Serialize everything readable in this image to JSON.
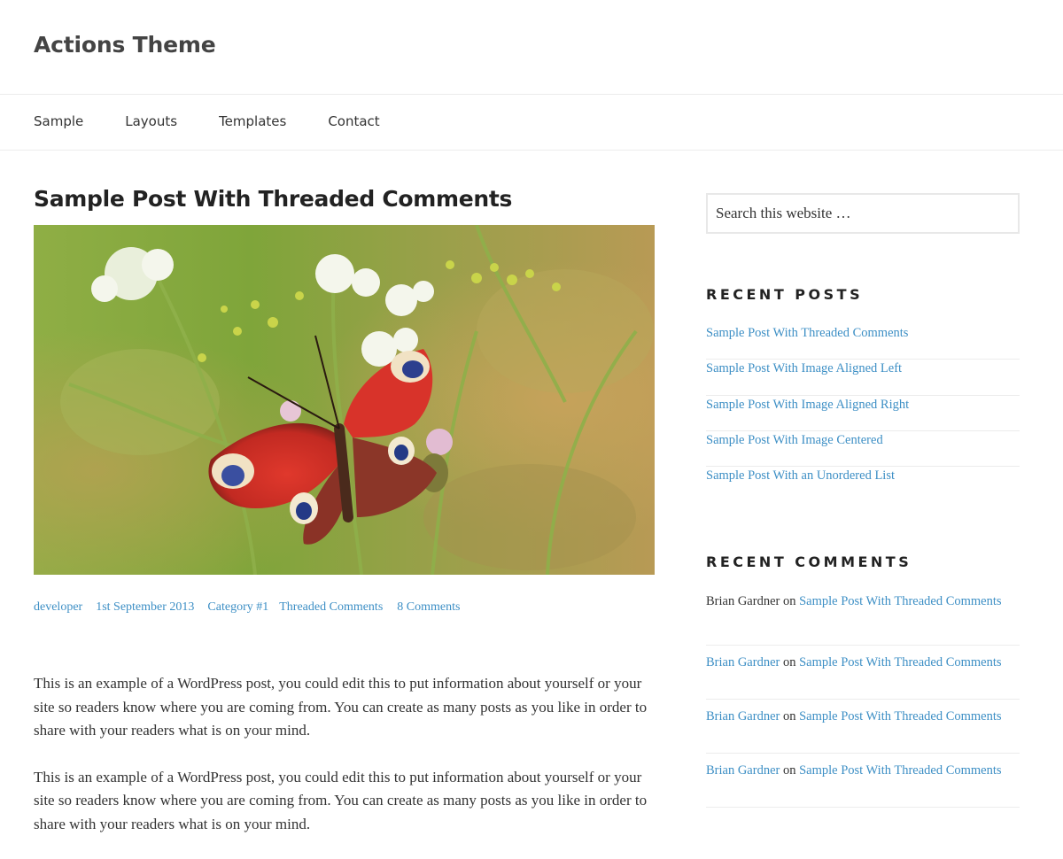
{
  "site": {
    "title": "Actions Theme"
  },
  "nav": {
    "items": [
      "Sample",
      "Layouts",
      "Templates",
      "Contact"
    ]
  },
  "post": {
    "title": "Sample Post With Threaded Comments",
    "meta": {
      "author": "developer",
      "date": "1st September 2013",
      "category": "Category #1",
      "tag": "Threaded Comments",
      "comments": "8 Comments"
    },
    "paragraphs": [
      "This is an example of a WordPress post, you could edit this to put information about yourself or your site so readers know where you are coming from. You can create as many posts as you like in order to share with your readers what is on your mind.",
      "This is an example of a WordPress post, you could edit this to put information about yourself or your site so readers know where you are coming from. You can create as many posts as you like in order to share with your readers what is on your mind."
    ]
  },
  "sidebar": {
    "search_placeholder": "Search this website …",
    "recent_posts": {
      "title": "RECENT POSTS",
      "items": [
        "Sample Post With Threaded Comments",
        "Sample Post With Image Aligned Left",
        "Sample Post With Image Aligned Right",
        "Sample Post With Image Centered",
        "Sample Post With an Unordered List"
      ]
    },
    "recent_comments": {
      "title": "RECENT COMMENTS",
      "items": [
        {
          "author": "Brian Gardner",
          "on": "on",
          "post": "Sample Post With Threaded Comments",
          "author_linked": false
        },
        {
          "author": "Brian Gardner",
          "on": "on",
          "post": "Sample Post With Threaded Comments",
          "author_linked": true
        },
        {
          "author": "Brian Gardner",
          "on": "on",
          "post": "Sample Post With Threaded Comments",
          "author_linked": true
        },
        {
          "author": "Brian Gardner",
          "on": "on",
          "post": "Sample Post With Threaded Comments",
          "author_linked": true
        }
      ]
    }
  },
  "colors": {
    "link": "#3d8fc5",
    "text": "#333333",
    "heading": "#222222",
    "border": "#ececec"
  },
  "image": {
    "subject": "peacock-butterfly-on-flowers"
  }
}
